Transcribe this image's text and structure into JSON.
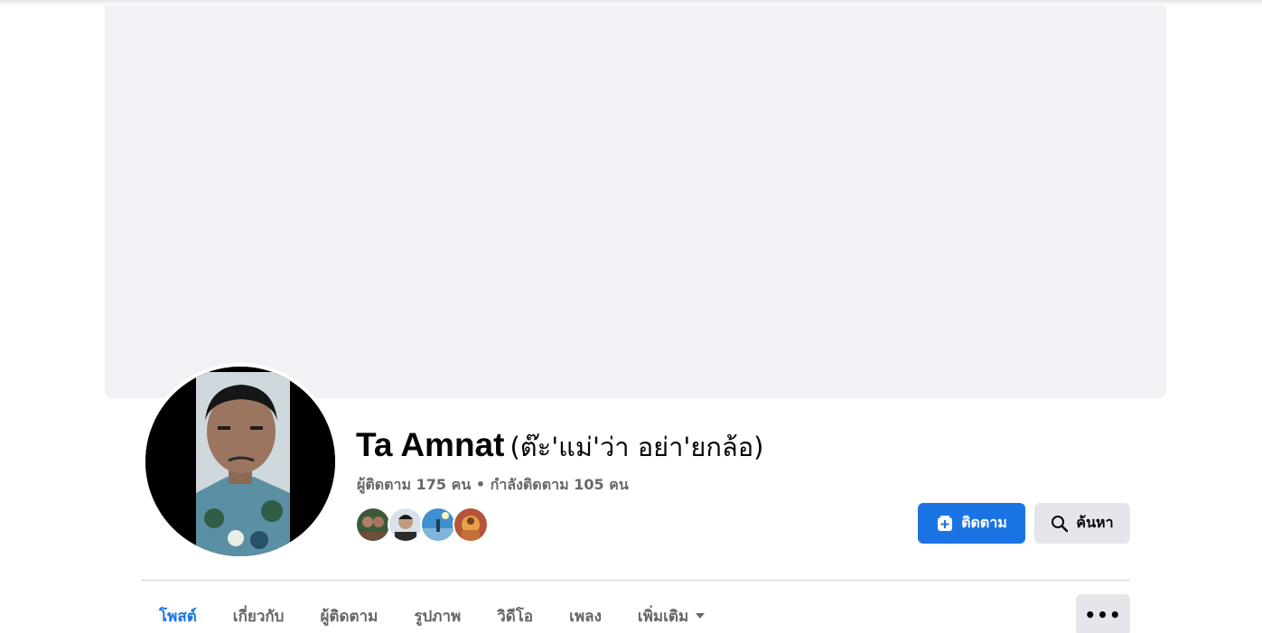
{
  "profile": {
    "name": "Ta Amnat",
    "alternate_name": "(ต๊ะ'แม่'ว่า อย่า'ยกล้อ)",
    "stats": "ผู้ติดตาม 175 คน • กำลังติดตาม 105 คน"
  },
  "actions": {
    "follow_label": "ติดตาม",
    "search_label": "ค้นหา",
    "more_label": "•••"
  },
  "tabs": [
    {
      "label": "โพสต์",
      "active": true
    },
    {
      "label": "เกี่ยวกับ"
    },
    {
      "label": "ผู้ติดตาม"
    },
    {
      "label": "รูปภาพ"
    },
    {
      "label": "วิดีโอ"
    },
    {
      "label": "เพลง"
    },
    {
      "label": "เพิ่มเติม"
    }
  ],
  "colors": {
    "accent": "#1b74e4",
    "cover_bg": "#f0f2f5",
    "secondary_text": "#65676b",
    "button_gray": "#e4e6eb"
  },
  "icons": {
    "follow": "add-follow-icon",
    "search": "magnifier-icon",
    "more_dropdown": "caret-down-icon",
    "more_options": "ellipsis-icon"
  }
}
